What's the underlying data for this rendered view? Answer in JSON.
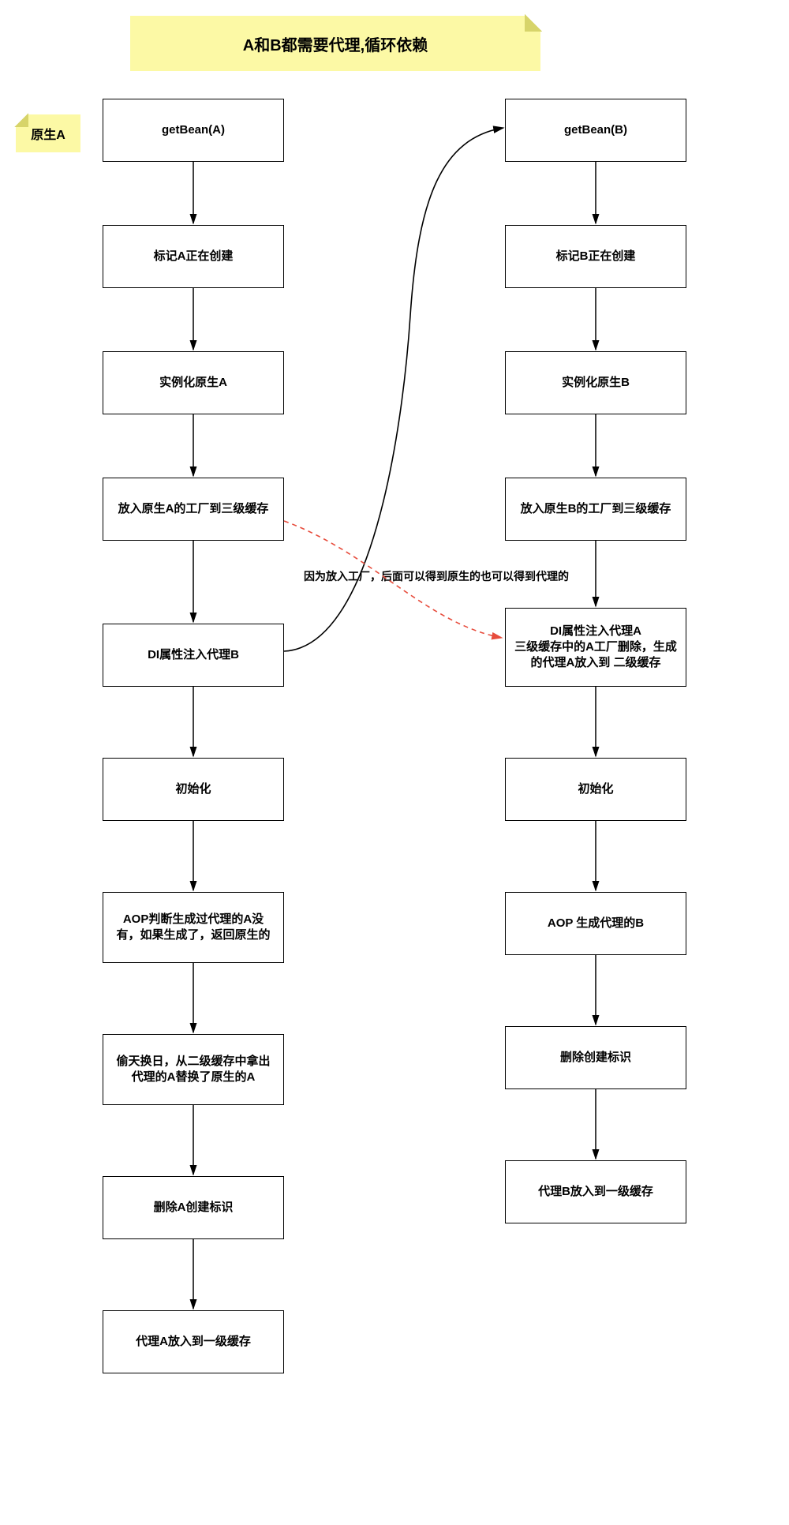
{
  "title": "A和B都需要代理,循环依赖",
  "note": "原生A",
  "edge_annotation": "因为放入工厂，后面可以得到原生的也可以得到代理的",
  "colA": {
    "b0": "getBean(A)",
    "b1": "标记A正在创建",
    "b2": "实例化原生A",
    "b3": "放入原生A的工厂到三级缓存",
    "b4": "DI属性注入代理B",
    "b5": "初始化",
    "b6": "AOP判断生成过代理的A没有，如果生成了，返回原生的",
    "b7": "偷天换日，从二级缓存中拿出代理的A替换了原生的A",
    "b8": "删除A创建标识",
    "b9": "代理A放入到一级缓存"
  },
  "colB": {
    "b0": "getBean(B)",
    "b1": "标记B正在创建",
    "b2": "实例化原生B",
    "b3": "放入原生B的工厂到三级缓存",
    "b4": "DI属性注入代理A\n三级缓存中的A工厂删除，生成的代理A放入到 二级缓存",
    "b5": "初始化",
    "b6": "AOP  生成代理的B",
    "b7": "删除创建标识",
    "b8": "代理B放入到一级缓存"
  }
}
